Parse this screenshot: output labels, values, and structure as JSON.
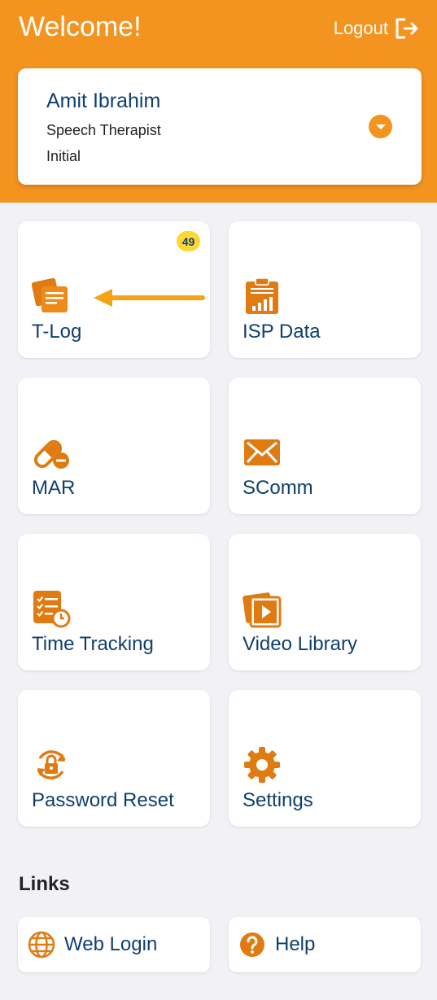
{
  "header": {
    "welcome": "Welcome!",
    "logout_label": "Logout"
  },
  "profile": {
    "name": "Amit Ibrahim",
    "role": "Speech Therapist",
    "status": "Initial"
  },
  "tiles": [
    {
      "label": "T-Log",
      "icon": "notes-icon",
      "badge": "49"
    },
    {
      "label": "ISP Data",
      "icon": "clipboard-chart-icon"
    },
    {
      "label": "MAR",
      "icon": "pill-icon"
    },
    {
      "label": "SComm",
      "icon": "envelope-icon"
    },
    {
      "label": "Time Tracking",
      "icon": "checklist-clock-icon"
    },
    {
      "label": "Video Library",
      "icon": "video-library-icon"
    },
    {
      "label": "Password Reset",
      "icon": "lock-reset-icon"
    },
    {
      "label": "Settings",
      "icon": "gear-icon"
    }
  ],
  "links": {
    "title": "Links",
    "items": [
      {
        "label": "Web Login",
        "icon": "globe-icon"
      },
      {
        "label": "Help",
        "icon": "question-icon"
      }
    ]
  },
  "colors": {
    "accent": "#f39420",
    "text_dark_blue": "#0f3f6f",
    "badge": "#fcd835",
    "background": "#f1f1f6",
    "icon_orange": "#e07b12"
  }
}
